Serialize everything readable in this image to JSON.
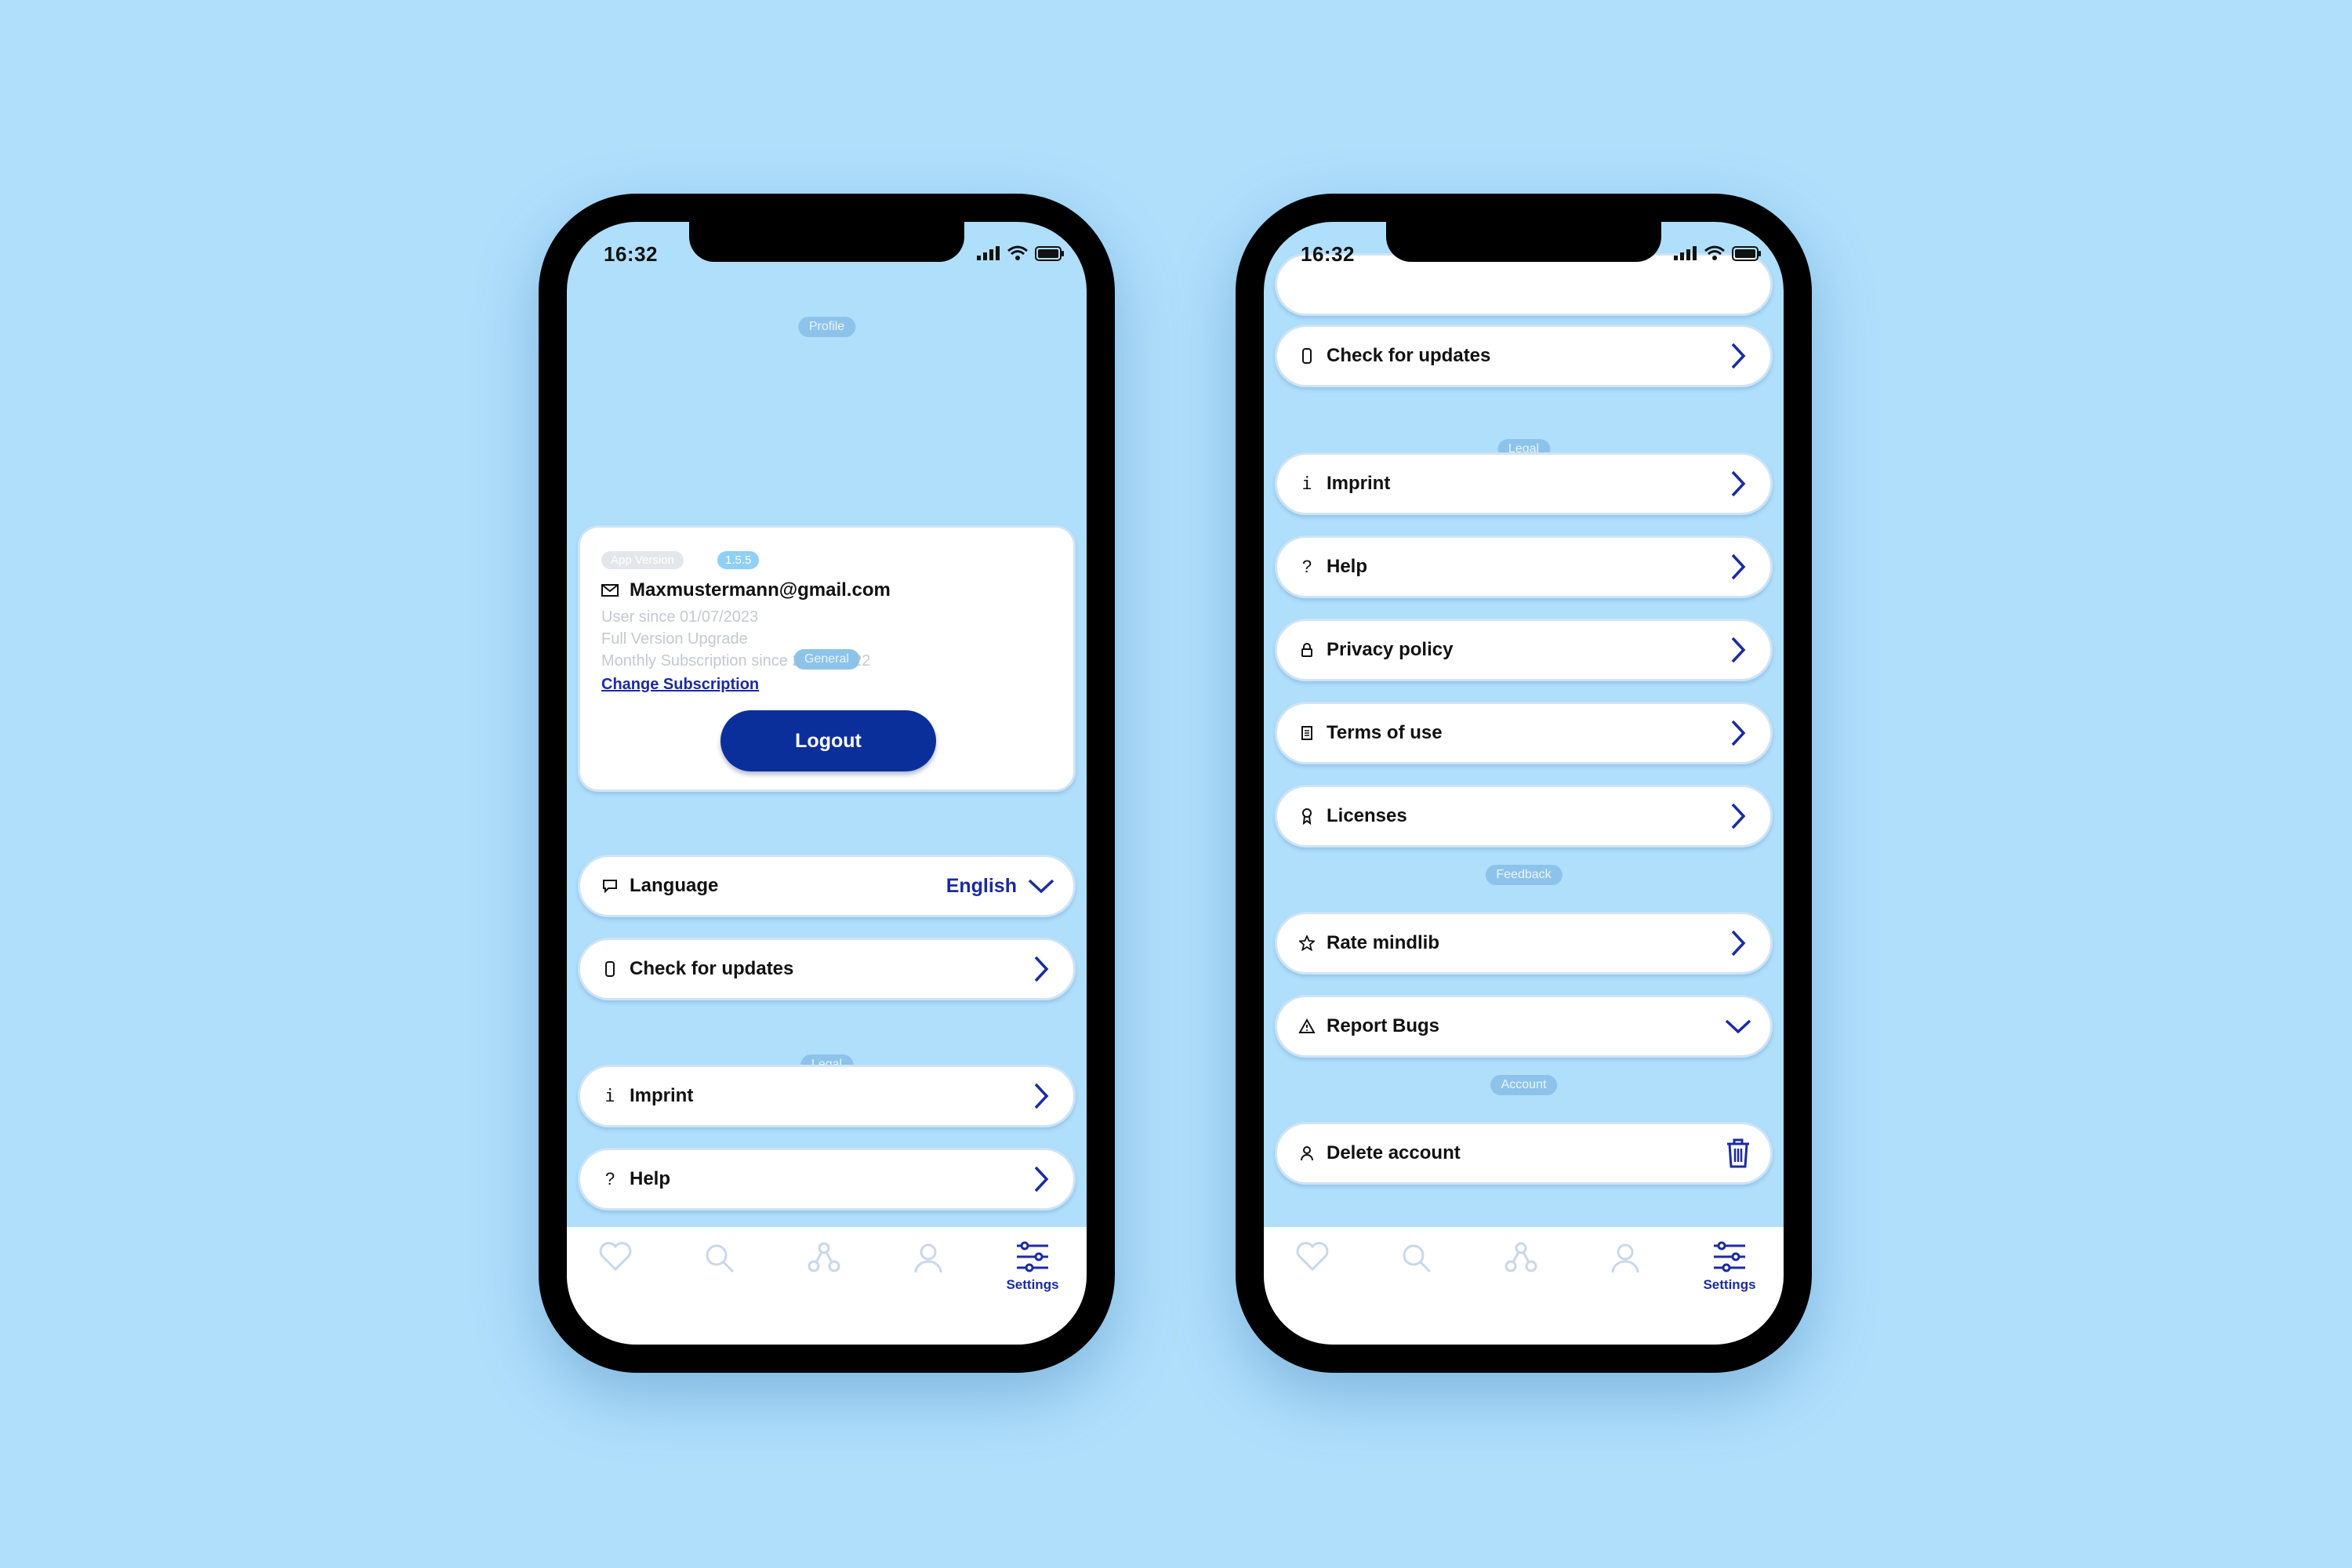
{
  "status_bar": {
    "time": "16:32"
  },
  "sections": {
    "profile": "Profile",
    "general": "General",
    "legal": "Legal",
    "feedback": "Feedback",
    "account": "Account"
  },
  "profile": {
    "app_version_label": "App Version",
    "app_version": "1.5.5",
    "email": "Maxmustermann@gmail.com",
    "user_since": "User since 01/07/2023",
    "upgrade": "Full Version Upgrade",
    "subscription": "Monthly Subscription since 22/02/2022",
    "change_subscription": "Change Subscription",
    "logout": "Logout"
  },
  "general": {
    "language_label": "Language",
    "language_value": "English",
    "check_updates": "Check for updates"
  },
  "legal": {
    "imprint": "Imprint",
    "help": "Help",
    "privacy": "Privacy policy",
    "terms": "Terms of use",
    "licenses": "Licenses"
  },
  "feedback": {
    "rate": "Rate mindlib",
    "report": "Report Bugs"
  },
  "account": {
    "delete": "Delete account"
  },
  "tabbar": {
    "settings": "Settings"
  },
  "colors": {
    "background": "#b0dffc",
    "accent": "#1b2ba0",
    "button": "#0b2f9a",
    "inactive_icon": "#c9d8e8"
  }
}
